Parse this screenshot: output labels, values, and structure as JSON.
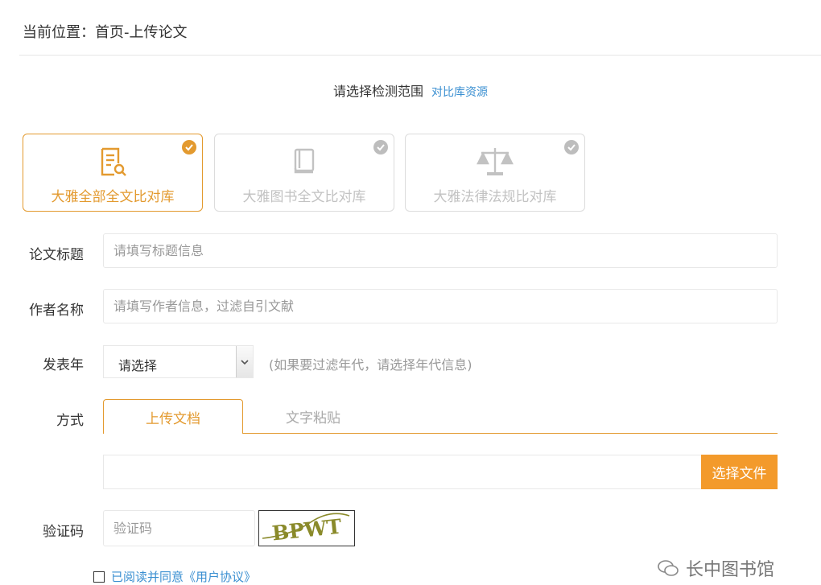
{
  "breadcrumb": "当前位置：首页-上传论文",
  "scope": {
    "title": "请选择检测范围",
    "link": "对比库资源"
  },
  "databases": [
    {
      "label": "大雅全部全文比对库",
      "icon": "document-search-icon",
      "selected": true
    },
    {
      "label": "大雅图书全文比对库",
      "icon": "book-icon",
      "selected": false
    },
    {
      "label": "大雅法律法规比对库",
      "icon": "scales-icon",
      "selected": false
    }
  ],
  "form": {
    "title_label": "论文标题",
    "title_placeholder": "请填写标题信息",
    "author_label": "作者名称",
    "author_placeholder": "请填写作者信息，过滤自引文献",
    "year_label": "发表年",
    "year_value": "请选择",
    "year_hint": "(如果要过滤年代，请选择年代信息)",
    "method_label": "方式",
    "tabs": [
      "上传文档",
      "文字粘贴"
    ],
    "file_button": "选择文件",
    "captcha_label": "验证码",
    "captcha_placeholder": "验证码",
    "captcha_text": "BPWT",
    "agreement": "已阅读并同意《用户协议》"
  },
  "watermark": "长中图书馆",
  "colors": {
    "accent": "#e39a2f",
    "button": "#f39a2b",
    "link": "#3a8fd1"
  }
}
